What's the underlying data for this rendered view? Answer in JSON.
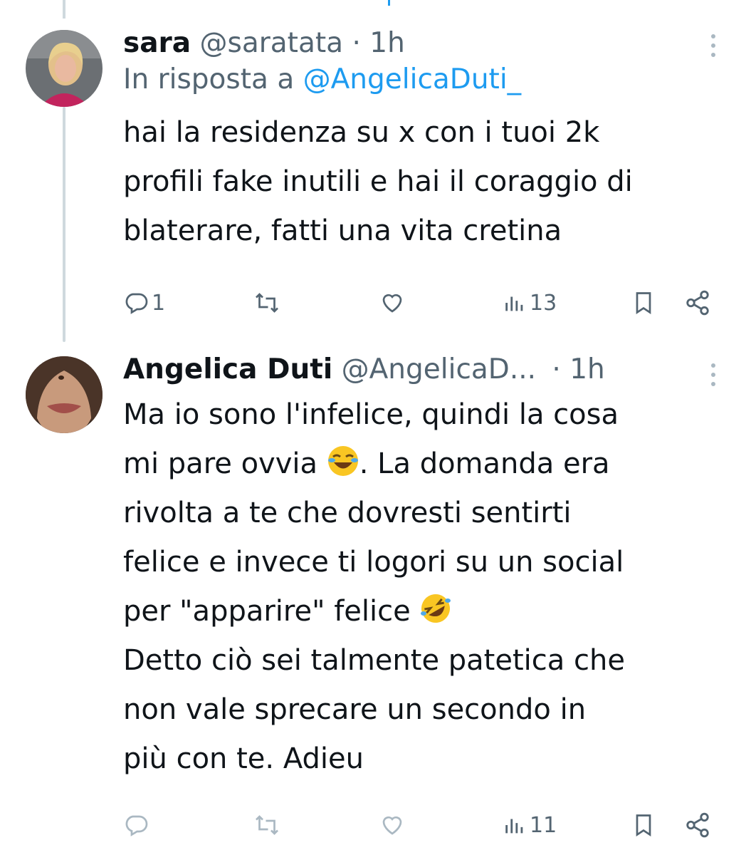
{
  "colors": {
    "text": "#0f1419",
    "muted": "#536471",
    "accent": "#1d9bf0",
    "thread": "#cfd9de"
  },
  "tweets": [
    {
      "name": "sara",
      "handle": "@saratata",
      "separator": "·",
      "time": "1h",
      "reply_prefix": "In risposta a ",
      "reply_mention": "@AngelicaDuti_",
      "text_lines": [
        "hai la residenza su x con i tuoi 2k",
        "profili fake inutili e hai il coraggio di",
        "blaterare, fatti una vita cretina"
      ],
      "actions": {
        "replies": "1",
        "reposts": "",
        "likes": "",
        "views": "13"
      }
    },
    {
      "name": "Angelica Duti",
      "handle": "@AngelicaD...",
      "separator": "·",
      "time": "1h",
      "text_line1": "Ma io sono l'infelice, quindi la cosa",
      "text_line2a": "mi pare ovvia ",
      "emoji1": "face-with-tears-of-joy",
      "text_line2b": ". La domanda era",
      "text_line3": "rivolta a te che dovresti sentirti",
      "text_line4": "felice e invece ti logori su un social",
      "text_line5a": "per \"apparire\" felice ",
      "emoji2": "rolling-on-the-floor-laughing",
      "text_line6": "Detto ciò sei talmente patetica che",
      "text_line7": "non vale sprecare un secondo in",
      "text_line8": "più con te. Adieu",
      "actions": {
        "replies": "",
        "reposts": "",
        "likes": "",
        "views": "11"
      }
    }
  ]
}
